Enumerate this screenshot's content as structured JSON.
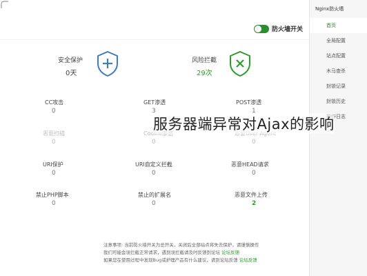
{
  "app": {
    "title": "Nginx防火墙"
  },
  "toggle": {
    "label": "防火墙开关",
    "on": true,
    "color": "#2e8b2e"
  },
  "cards": [
    {
      "label": "风险拦截",
      "value": "29次",
      "value_color": "#2e9b2e",
      "icon": "shield-x-icon"
    },
    {
      "label": "安全保护",
      "value": "0天",
      "value_color": "#444444",
      "icon": "shield-plus-icon"
    }
  ],
  "rules": [
    {
      "label": "POST渗透",
      "value": "1"
    },
    {
      "label": "GET渗透",
      "value": "3"
    },
    {
      "label": "CC攻击",
      "value": "0"
    },
    {
      "label": "恶意User-Agent",
      "value": "0",
      "faded": true
    },
    {
      "label": "Cookie渗透",
      "value": "0",
      "faded": true
    },
    {
      "label": "恶意扫描",
      "value": "0",
      "faded": true
    },
    {
      "label": "恶意HEAD请求",
      "value": "0"
    },
    {
      "label": "URI自定义拦截",
      "value": "0"
    },
    {
      "label": "URI保护",
      "value": "0"
    },
    {
      "label": "恶意文件上传",
      "value": "2",
      "highlight": true
    },
    {
      "label": "禁止的扩展名",
      "value": "0"
    },
    {
      "label": "禁止PHP脚本",
      "value": "0"
    }
  ],
  "notice": {
    "lines": [
      {
        "text": "注意事项: 当前防火墙开关为总开关，关闭后全部站点将失去保护，请谨慎操作",
        "link": ""
      },
      {
        "text": "我们可能会误拦截正常请求，遇到误拦截请及时反馈到论坛",
        "link": "论坛反馈"
      },
      {
        "text": "如果您在使用过程中发现Bug或护理产品有什么建议，请到论坛反馈",
        "link": "论坛反馈"
      }
    ]
  },
  "sidebar": {
    "items": [
      {
        "label": "首页",
        "active": true
      },
      {
        "label": "全局配置"
      },
      {
        "label": "站点配置"
      },
      {
        "label": "木马查杀"
      },
      {
        "label": "封锁记录"
      },
      {
        "label": "封锁历史"
      },
      {
        "label": "操作日志"
      }
    ]
  },
  "caption": "服务器端异常对Ajax的影响"
}
